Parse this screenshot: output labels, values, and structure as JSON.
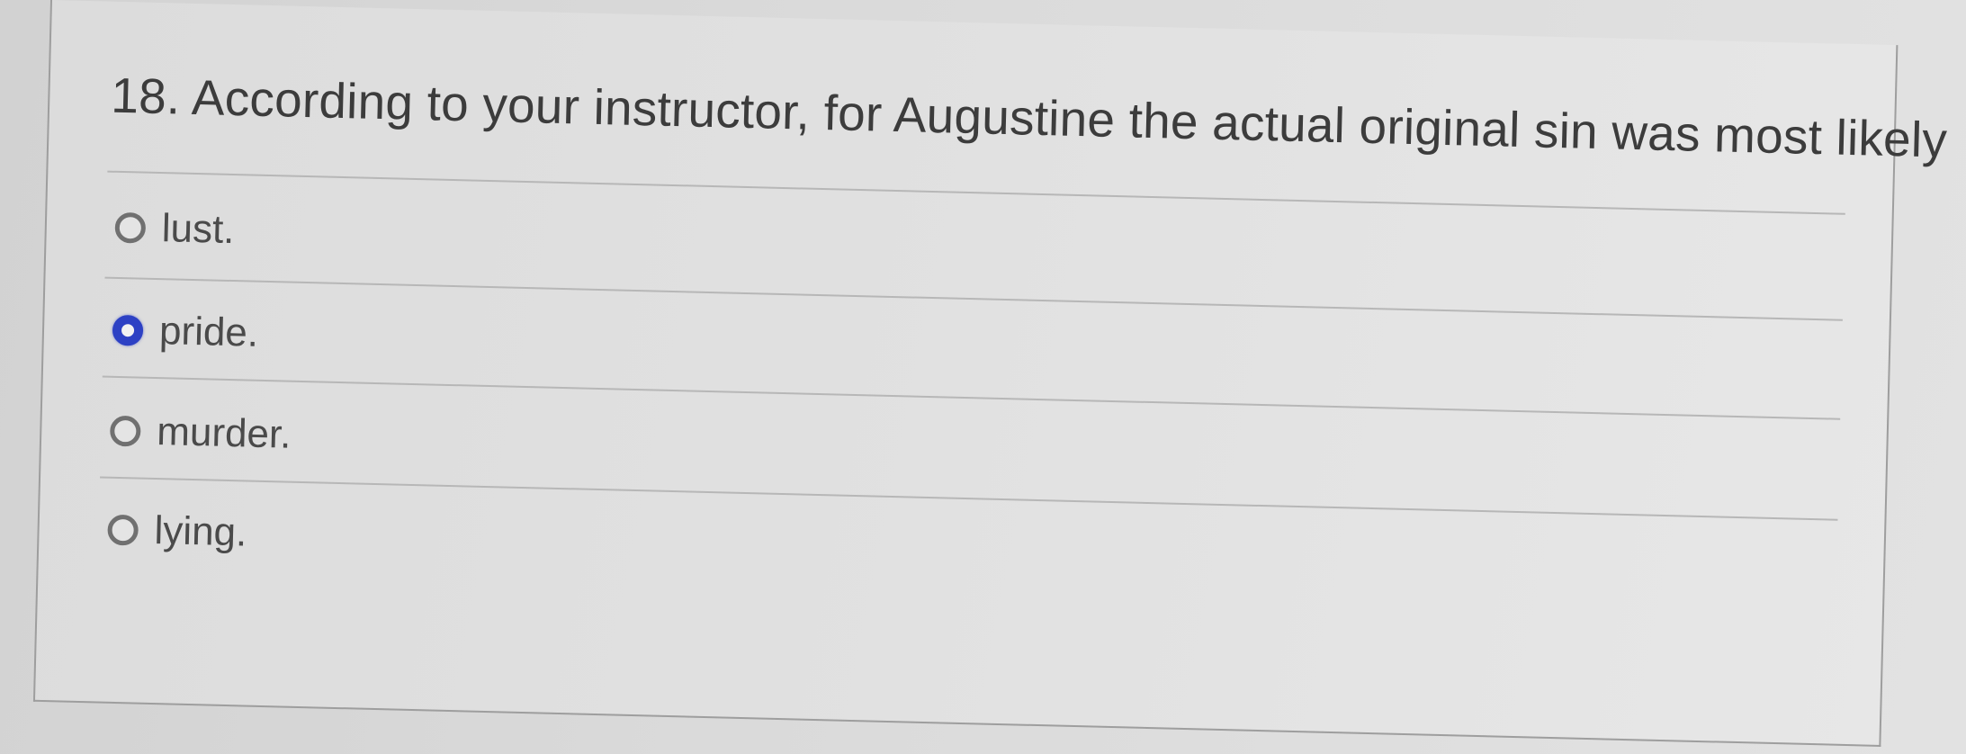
{
  "question": {
    "text": "18. According to your instructor, for Augustine the actual original sin was most likely"
  },
  "options": [
    {
      "label": "lust.",
      "selected": false
    },
    {
      "label": "pride.",
      "selected": true
    },
    {
      "label": "murder.",
      "selected": false
    },
    {
      "label": "lying.",
      "selected": false
    }
  ],
  "colors": {
    "radio_selected": "#2d41c4",
    "text": "#3c3c3c"
  }
}
